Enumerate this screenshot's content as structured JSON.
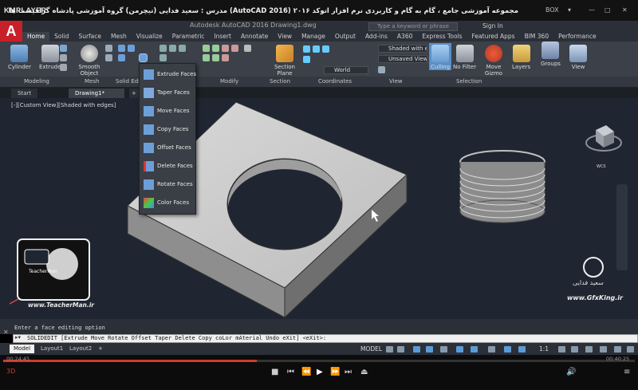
{
  "player": {
    "logo": "KMPLAYER",
    "video_title": "مجموعه آموزشی جامع ، گام به گام و کاربردی نرم افزار اتوکد ۲۰۱۶ (AutoCAD 2016) مدرس : سعید فدایی (تیچرمن) گروه آموزشی پادشاه گرافیست ها",
    "box_label": "BOX",
    "time_elapsed": "00:24:45",
    "time_total": "00:40:25"
  },
  "acad": {
    "app_letter": "A",
    "doc_title": "Autodesk AutoCAD 2016   Drawing1.dwg",
    "search_placeholder": "Type a keyword or phrase",
    "signin": "Sign In"
  },
  "ribbon_tabs": [
    "Home",
    "Solid",
    "Surface",
    "Mesh",
    "Visualize",
    "Parametric",
    "Insert",
    "Annotate",
    "View",
    "Manage",
    "Output",
    "Add-ins",
    "A360",
    "Express Tools",
    "Featured Apps",
    "BIM 360",
    "Performance"
  ],
  "ribbon": {
    "cylinder": "Cylinder",
    "extrude": "Extrude",
    "smooth_object": "Smooth Object",
    "section_plane": "Section Plane",
    "culling": "Culling",
    "no_filter": "No Filter",
    "move_gizmo": "Move Gizmo",
    "layers": "Layers",
    "groups": "Groups",
    "view": "View",
    "visual_style": "Shaded with e...",
    "saved_view": "Unsaved View",
    "ucs": "World",
    "panels": [
      "Modeling",
      "Mesh",
      "Solid Edit",
      "Modify",
      "Section",
      "Coordinates",
      "View",
      "Selection"
    ]
  },
  "file_tabs": [
    "Start",
    "Drawing1*"
  ],
  "viewport": {
    "label": "[-][Custom View][Shaded with edges]",
    "viewcube_label": "WCS"
  },
  "face_menu": [
    {
      "label": "Extrude Faces",
      "icon": "extrude-faces-icon"
    },
    {
      "label": "Taper Faces",
      "icon": "taper-faces-icon"
    },
    {
      "label": "Move Faces",
      "icon": "move-faces-icon"
    },
    {
      "label": "Copy Faces",
      "icon": "copy-faces-icon"
    },
    {
      "label": "Offset Faces",
      "icon": "offset-faces-icon"
    },
    {
      "label": "Delete Faces",
      "icon": "delete-faces-icon"
    },
    {
      "label": "Rotate Faces",
      "icon": "rotate-faces-icon"
    },
    {
      "label": "Color Faces",
      "icon": "color-faces-icon"
    }
  ],
  "command": {
    "history": "Enter a face editing option",
    "current": "SOLIDEDIT [Extrude Move Rotate Offset Taper Delete Copy coLor mAterial Undo eXit] <eXit>:"
  },
  "layout_tabs": [
    "Model",
    "Layout1",
    "Layout2"
  ],
  "status": {
    "model": "MODEL",
    "scale": "1:1"
  },
  "watermarks": {
    "teacherman_url": "www.TeacherMan.ir",
    "teacherman_name": "TeacherMan",
    "gfxking_url": "www.GfxKing.ir",
    "author_name": "سعید فدایی"
  }
}
